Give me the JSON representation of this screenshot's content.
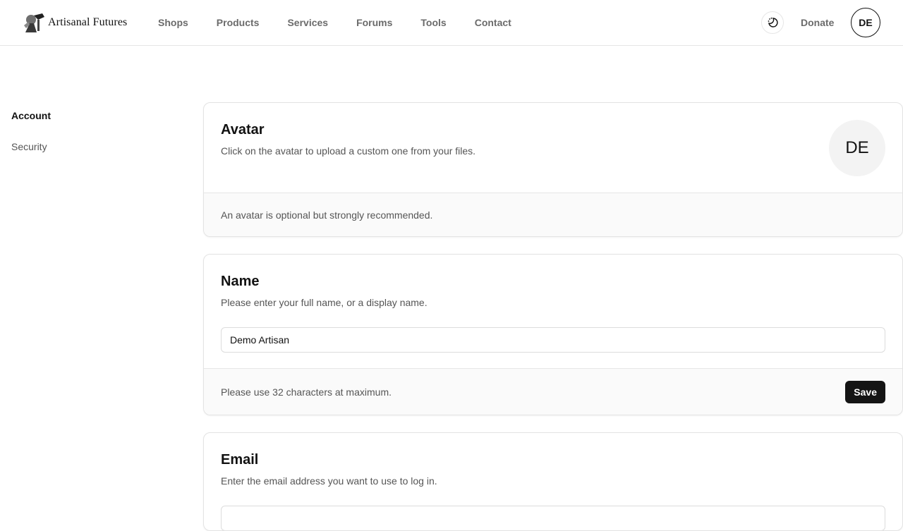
{
  "header": {
    "brand_name": "Artisanal Futures",
    "nav": [
      "Shops",
      "Products",
      "Services",
      "Forums",
      "Tools",
      "Contact"
    ],
    "theme_toggle_icon": "moon-sun-icon",
    "donate_label": "Donate",
    "user_initials": "DE"
  },
  "sidebar": {
    "items": [
      {
        "label": "Account",
        "active": true
      },
      {
        "label": "Security",
        "active": false
      }
    ]
  },
  "avatar_card": {
    "title": "Avatar",
    "description": "Click on the avatar to upload a custom one from your files.",
    "initials": "DE",
    "footer": "An avatar is optional but strongly recommended."
  },
  "name_card": {
    "title": "Name",
    "description": "Please enter your full name, or a display name.",
    "input_value": "Demo Artisan",
    "footer": "Please use 32 characters at maximum.",
    "save_label": "Save"
  },
  "email_card": {
    "title": "Email",
    "description": "Enter the email address you want to use to log in."
  },
  "colors": {
    "accent": "#141414",
    "muted_text": "#6b6b6b",
    "border": "#e3e3e3",
    "footer_bg": "#fafafa"
  }
}
